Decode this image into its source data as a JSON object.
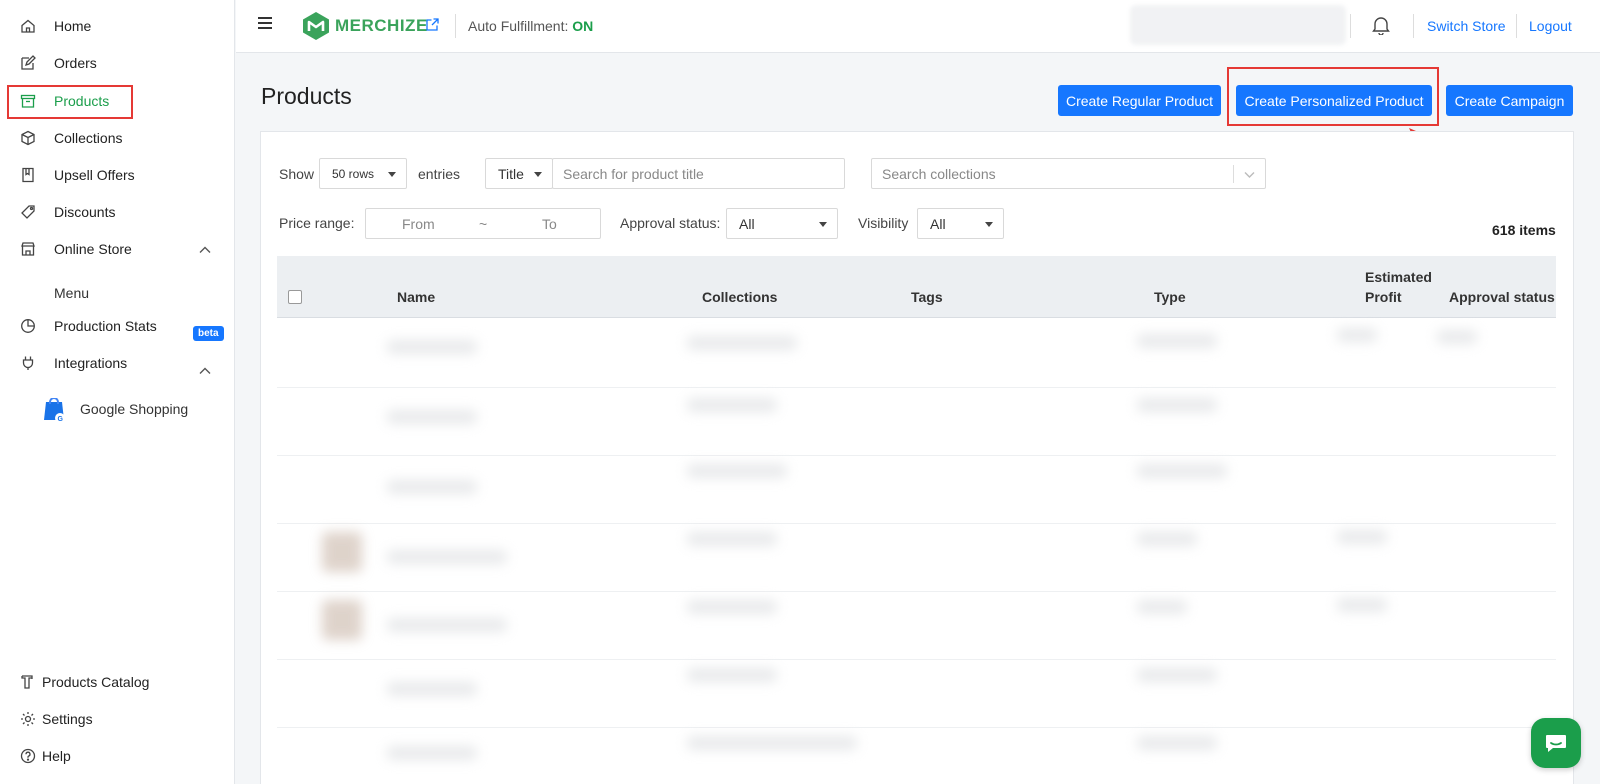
{
  "sidebar": {
    "items": [
      {
        "label": "Home",
        "icon": "home-icon"
      },
      {
        "label": "Orders",
        "icon": "edit-icon"
      },
      {
        "label": "Products",
        "icon": "box-icon"
      },
      {
        "label": "Collections",
        "icon": "cube-icon"
      },
      {
        "label": "Upsell Offers",
        "icon": "book-icon"
      },
      {
        "label": "Discounts",
        "icon": "tag-icon"
      },
      {
        "label": "Online Store",
        "icon": "store-icon"
      },
      {
        "label": "Production Stats",
        "icon": "pie-icon"
      },
      {
        "label": "Integrations",
        "icon": "plug-icon"
      }
    ],
    "online_store_sub": "Menu",
    "integrations_sub": "Google Shopping",
    "beta_badge": "beta",
    "bottom": [
      {
        "label": "Products Catalog",
        "icon": "catalog-icon"
      },
      {
        "label": "Settings",
        "icon": "gear-icon"
      },
      {
        "label": "Help",
        "icon": "help-icon"
      }
    ],
    "active_color": "#1b9e4b"
  },
  "topbar": {
    "logo_text": "MERCHIZE",
    "auto_fulfillment_label": "Auto Fulfillment:",
    "auto_fulfillment_value": "ON",
    "switch_store": "Switch Store",
    "logout": "Logout"
  },
  "page": {
    "title": "Products",
    "buttons": {
      "create_regular": "Create Regular Product",
      "create_personalized": "Create Personalized Product",
      "create_campaign": "Create Campaign"
    }
  },
  "filters": {
    "show_label": "Show",
    "rows_value": "50 rows",
    "entries_label": "entries",
    "search_type": "Title",
    "search_placeholder": "Search for product title",
    "collections_placeholder": "Search collections",
    "price_range_label": "Price range:",
    "price_from_placeholder": "From",
    "price_sep": "~",
    "price_to_placeholder": "To",
    "approval_label": "Approval status:",
    "approval_value": "All",
    "visibility_label": "Visibility",
    "visibility_value": "All"
  },
  "table": {
    "items_count": "618 items",
    "columns": {
      "name": "Name",
      "collections": "Collections",
      "tags": "Tags",
      "type": "Type",
      "estimated_profit_line1": "Estimated",
      "estimated_profit_line2": "Profit",
      "approval_status": "Approval status"
    }
  },
  "colors": {
    "primary_button": "#1677ff",
    "annotation_red": "#e53935",
    "brand_green": "#3aa35b"
  }
}
